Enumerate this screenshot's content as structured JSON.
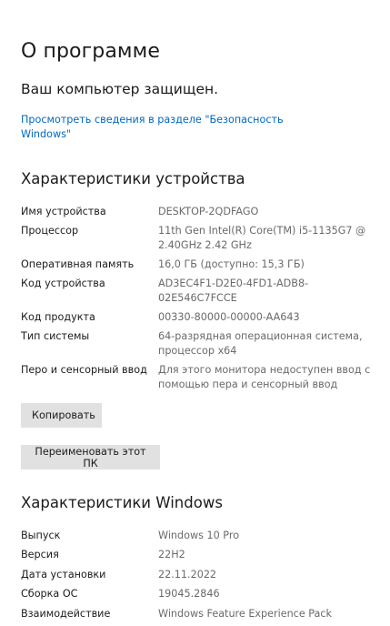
{
  "page": {
    "title": "О программе",
    "protected_status": "Ваш компьютер защищен.",
    "security_link": "Просмотреть сведения в разделе \"Безопасность Windows\""
  },
  "device_specs": {
    "title": "Характеристики устройства",
    "rows": [
      {
        "label": "Имя устройства",
        "value": "DESKTOP-2QDFAGO"
      },
      {
        "label": "Процессор",
        "value": "11th Gen Intel(R) Core(TM) i5-1135G7 @ 2.40GHz   2.42 GHz"
      },
      {
        "label": "Оперативная память",
        "value": "16,0 ГБ (доступно: 15,3 ГБ)"
      },
      {
        "label": "Код устройства",
        "value": "AD3EC4F1-D2E0-4FD1-ADB8-02E546C7FCCE"
      },
      {
        "label": "Код продукта",
        "value": "00330-80000-00000-AA643"
      },
      {
        "label": "Тип системы",
        "value": "64-разрядная операционная система, процессор x64"
      },
      {
        "label": "Перо и сенсорный ввод",
        "value": "Для этого монитора недоступен ввод с помощью пера и сенсорный ввод"
      }
    ],
    "copy_button": "Копировать",
    "rename_button": "Переименовать этот ПК"
  },
  "windows_specs": {
    "title": "Характеристики Windows",
    "rows": [
      {
        "label": "Выпуск",
        "value": "Windows 10 Pro"
      },
      {
        "label": "Версия",
        "value": "22H2"
      },
      {
        "label": "Дата установки",
        "value": "22.11.2022"
      },
      {
        "label": "Сборка ОС",
        "value": "19045.2846"
      },
      {
        "label": "Взаимодействие",
        "value": "Windows Feature Experience Pack"
      }
    ]
  },
  "colors": {
    "link": "#0067c0",
    "value_text": "#6a6a6a",
    "button_bg": "#e1e1e1"
  }
}
